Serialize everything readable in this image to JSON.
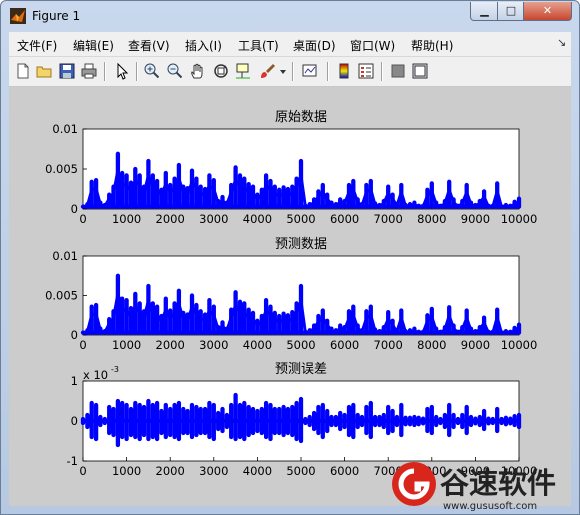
{
  "window": {
    "title": "Figure 1",
    "buttons": {
      "minimize": "▁",
      "maximize": "□",
      "close": "✕"
    }
  },
  "menu": {
    "items": [
      "文件(F)",
      "编辑(E)",
      "查看(V)",
      "插入(I)",
      "工具(T)",
      "桌面(D)",
      "窗口(W)",
      "帮助(H)"
    ],
    "overflow": "↘"
  },
  "toolbar": {
    "icons": [
      "new-figure-icon",
      "open-file-icon",
      "save-icon",
      "print-icon",
      "edit-plot-arrow-icon",
      "zoom-in-icon",
      "zoom-out-icon",
      "pan-hand-icon",
      "rotate-3d-icon",
      "data-cursor-icon",
      "brush-icon",
      "brush-dropdown-icon",
      "link-plot-icon",
      "colorbar-icon",
      "legend-icon",
      "hide-plot-tools-icon",
      "show-plot-tools-icon"
    ]
  },
  "chart_data": [
    {
      "type": "line",
      "title": "原始数据",
      "xlim": [
        0,
        10000
      ],
      "ylim": [
        0,
        0.01
      ],
      "x_ticks": [
        0,
        1000,
        2000,
        3000,
        4000,
        5000,
        6000,
        7000,
        8000,
        9000,
        10000
      ],
      "y_ticks": [
        "0",
        "0.005",
        "0.01"
      ],
      "y_tick_values": [
        0,
        0.005,
        0.01
      ],
      "series": [
        {
          "color": "#0000ff",
          "x": [
            0,
            100,
            200,
            300,
            400,
            500,
            600,
            700,
            800,
            900,
            1000,
            1100,
            1200,
            1300,
            1400,
            1500,
            1600,
            1700,
            1800,
            1900,
            2000,
            2100,
            2200,
            2300,
            2400,
            2500,
            2600,
            2700,
            2800,
            2900,
            3000,
            3100,
            3200,
            3300,
            3400,
            3500,
            3600,
            3700,
            3800,
            3900,
            4000,
            4100,
            4200,
            4300,
            4400,
            4500,
            4600,
            4700,
            4800,
            4900,
            5000,
            5100,
            5200,
            5300,
            5400,
            5500,
            5600,
            5700,
            5800,
            5900,
            6000,
            6100,
            6200,
            6300,
            6400,
            6500,
            6600,
            6700,
            6800,
            6900,
            7000,
            7100,
            7200,
            7300,
            7400,
            7500,
            7600,
            7700,
            7800,
            7900,
            8000,
            8100,
            8200,
            8300,
            8400,
            8500,
            8600,
            8700,
            8800,
            8900,
            9000,
            9100,
            9200,
            9300,
            9400,
            9500,
            9600,
            9700,
            9800,
            9900,
            10000
          ],
          "y": [
            0.0003,
            0.0006,
            0.0034,
            0.0036,
            0.0008,
            0.0005,
            0.0018,
            0.0028,
            0.0069,
            0.0045,
            0.0042,
            0.0033,
            0.005,
            0.0042,
            0.0028,
            0.006,
            0.0042,
            0.0035,
            0.0024,
            0.0045,
            0.003,
            0.0038,
            0.0055,
            0.0028,
            0.0026,
            0.0048,
            0.0038,
            0.0028,
            0.0025,
            0.0042,
            0.0036,
            0.001,
            0.0015,
            0.0008,
            0.003,
            0.0052,
            0.0042,
            0.0038,
            0.0031,
            0.0028,
            0.0018,
            0.0024,
            0.0042,
            0.0035,
            0.0028,
            0.0024,
            0.0027,
            0.0025,
            0.0028,
            0.0038,
            0.006,
            0.0004,
            0.0006,
            0.0012,
            0.0022,
            0.003,
            0.0018,
            0.0008,
            0.0006,
            0.0012,
            0.001,
            0.003,
            0.0035,
            0.0012,
            0.0006,
            0.003,
            0.0035,
            0.0007,
            0.0005,
            0.001,
            0.0028,
            0.0018,
            0.0006,
            0.003,
            0.0005,
            0.0006,
            0.0008,
            0.0004,
            0.0004,
            0.0024,
            0.0032,
            0.0008,
            0.0004,
            0.001,
            0.0034,
            0.0012,
            0.0004,
            0.001,
            0.003,
            0.0008,
            0.0005,
            0.001,
            0.0022,
            0.0004,
            0.0004,
            0.0032,
            0.0003,
            0.0005,
            0.0004,
            0.0009,
            0.0013
          ]
        }
      ]
    },
    {
      "type": "line",
      "title": "预测数据",
      "xlim": [
        0,
        10000
      ],
      "ylim": [
        0,
        0.01
      ],
      "x_ticks": [
        0,
        1000,
        2000,
        3000,
        4000,
        5000,
        6000,
        7000,
        8000,
        9000,
        10000
      ],
      "y_ticks": [
        "0",
        "0.005",
        "0.01"
      ],
      "y_tick_values": [
        0,
        0.005,
        0.01
      ],
      "series": [
        {
          "color": "#0000ff",
          "x": [
            0,
            100,
            200,
            300,
            400,
            500,
            600,
            700,
            800,
            900,
            1000,
            1100,
            1200,
            1300,
            1400,
            1500,
            1600,
            1700,
            1800,
            1900,
            2000,
            2100,
            2200,
            2300,
            2400,
            2500,
            2600,
            2700,
            2800,
            2900,
            3000,
            3100,
            3200,
            3300,
            3400,
            3500,
            3600,
            3700,
            3800,
            3900,
            4000,
            4100,
            4200,
            4300,
            4400,
            4500,
            4600,
            4700,
            4800,
            4900,
            5000,
            5100,
            5200,
            5300,
            5400,
            5500,
            5600,
            5700,
            5800,
            5900,
            6000,
            6100,
            6200,
            6300,
            6400,
            6500,
            6600,
            6700,
            6800,
            6900,
            7000,
            7100,
            7200,
            7300,
            7400,
            7500,
            7600,
            7700,
            7800,
            7900,
            8000,
            8100,
            8200,
            8300,
            8400,
            8500,
            8600,
            8700,
            8800,
            8900,
            9000,
            9100,
            9200,
            9300,
            9400,
            9500,
            9600,
            9700,
            9800,
            9900,
            10000
          ],
          "y": [
            0.0003,
            0.0006,
            0.0036,
            0.0038,
            0.0008,
            0.0005,
            0.002,
            0.003,
            0.0075,
            0.0046,
            0.0044,
            0.0034,
            0.0052,
            0.004,
            0.003,
            0.0062,
            0.004,
            0.0036,
            0.0024,
            0.0046,
            0.0031,
            0.004,
            0.0056,
            0.0028,
            0.0026,
            0.005,
            0.0038,
            0.003,
            0.0026,
            0.0044,
            0.0036,
            0.001,
            0.0016,
            0.0008,
            0.0032,
            0.0054,
            0.0042,
            0.004,
            0.0032,
            0.0028,
            0.0018,
            0.0024,
            0.0044,
            0.0036,
            0.0028,
            0.0024,
            0.0027,
            0.0025,
            0.0029,
            0.004,
            0.0062,
            0.0004,
            0.0006,
            0.0012,
            0.0024,
            0.0031,
            0.0018,
            0.0008,
            0.0006,
            0.0012,
            0.001,
            0.003,
            0.0036,
            0.0012,
            0.0006,
            0.003,
            0.0036,
            0.0007,
            0.0005,
            0.001,
            0.0029,
            0.0018,
            0.0006,
            0.0031,
            0.0005,
            0.0006,
            0.0008,
            0.0004,
            0.0004,
            0.0025,
            0.0033,
            0.0008,
            0.0004,
            0.001,
            0.0035,
            0.0012,
            0.0004,
            0.001,
            0.0031,
            0.0008,
            0.0005,
            0.001,
            0.0022,
            0.0004,
            0.0004,
            0.0032,
            0.0003,
            0.0005,
            0.0004,
            0.0009,
            0.0013
          ]
        }
      ]
    },
    {
      "type": "line",
      "title": "预测误差",
      "xlim": [
        0,
        10000
      ],
      "ylim": [
        -1,
        1
      ],
      "exponent_label": "x 10",
      "exponent_power": "-3",
      "x_ticks": [
        0,
        1000,
        2000,
        3000,
        4000,
        5000,
        6000,
        7000,
        8000,
        9000,
        10000
      ],
      "y_ticks": [
        "-1",
        "0",
        "1"
      ],
      "y_tick_values": [
        -1,
        0,
        1
      ],
      "series": [
        {
          "color": "#0000ff",
          "x": [
            0,
            100,
            200,
            300,
            400,
            500,
            600,
            700,
            800,
            900,
            1000,
            1100,
            1200,
            1300,
            1400,
            1500,
            1600,
            1700,
            1800,
            1900,
            2000,
            2100,
            2200,
            2300,
            2400,
            2500,
            2600,
            2700,
            2800,
            2900,
            3000,
            3100,
            3200,
            3300,
            3400,
            3500,
            3600,
            3700,
            3800,
            3900,
            4000,
            4100,
            4200,
            4300,
            4400,
            4500,
            4600,
            4700,
            4800,
            4900,
            5000,
            5100,
            5200,
            5300,
            5400,
            5500,
            5600,
            5700,
            5800,
            5900,
            6000,
            6100,
            6200,
            6300,
            6400,
            6500,
            6600,
            6700,
            6800,
            6900,
            7000,
            7100,
            7200,
            7300,
            7400,
            7500,
            7600,
            7700,
            7800,
            7900,
            8000,
            8100,
            8200,
            8300,
            8400,
            8500,
            8600,
            8700,
            8800,
            8900,
            9000,
            9100,
            9200,
            9300,
            9400,
            9500,
            9600,
            9700,
            9800,
            9900,
            10000
          ],
          "y_upper": [
            0.05,
            0.15,
            0.45,
            0.4,
            0.1,
            0.05,
            0.35,
            0.3,
            0.5,
            0.45,
            0.4,
            0.3,
            0.45,
            0.4,
            0.35,
            0.5,
            0.4,
            0.45,
            0.25,
            0.4,
            0.3,
            0.4,
            0.45,
            0.3,
            0.25,
            0.4,
            0.35,
            0.3,
            0.3,
            0.45,
            0.4,
            0.2,
            0.3,
            0.15,
            0.4,
            0.65,
            0.4,
            0.45,
            0.35,
            0.3,
            0.25,
            0.3,
            0.45,
            0.4,
            0.3,
            0.3,
            0.35,
            0.3,
            0.35,
            0.45,
            0.55,
            0.05,
            0.1,
            0.2,
            0.35,
            0.4,
            0.25,
            0.1,
            0.1,
            0.2,
            0.15,
            0.35,
            0.4,
            0.15,
            0.1,
            0.35,
            0.45,
            0.1,
            0.1,
            0.15,
            0.35,
            0.25,
            0.1,
            0.4,
            0.08,
            0.08,
            0.1,
            0.08,
            0.06,
            0.3,
            0.35,
            0.1,
            0.05,
            0.15,
            0.4,
            0.15,
            0.05,
            0.15,
            0.35,
            0.1,
            0.06,
            0.1,
            0.25,
            0.06,
            0.05,
            0.3,
            0.05,
            0.08,
            0.06,
            0.12,
            0.15
          ],
          "y_lower": [
            -0.05,
            -0.15,
            -0.4,
            -0.45,
            -0.1,
            -0.05,
            -0.3,
            -0.35,
            -0.6,
            -0.4,
            -0.45,
            -0.35,
            -0.4,
            -0.45,
            -0.35,
            -0.45,
            -0.4,
            -0.45,
            -0.3,
            -0.4,
            -0.35,
            -0.4,
            -0.45,
            -0.3,
            -0.3,
            -0.4,
            -0.35,
            -0.3,
            -0.3,
            -0.4,
            -0.45,
            -0.2,
            -0.25,
            -0.15,
            -0.4,
            -0.45,
            -0.4,
            -0.45,
            -0.35,
            -0.3,
            -0.25,
            -0.3,
            -0.4,
            -0.45,
            -0.3,
            -0.3,
            -0.35,
            -0.3,
            -0.35,
            -0.45,
            -0.5,
            -0.05,
            -0.1,
            -0.2,
            -0.3,
            -0.4,
            -0.25,
            -0.1,
            -0.1,
            -0.2,
            -0.15,
            -0.35,
            -0.4,
            -0.15,
            -0.1,
            -0.3,
            -0.4,
            -0.1,
            -0.1,
            -0.15,
            -0.3,
            -0.25,
            -0.1,
            -0.35,
            -0.08,
            -0.08,
            -0.1,
            -0.08,
            -0.06,
            -0.25,
            -0.3,
            -0.1,
            -0.05,
            -0.15,
            -0.35,
            -0.15,
            -0.05,
            -0.15,
            -0.3,
            -0.1,
            -0.06,
            -0.1,
            -0.2,
            -0.06,
            -0.05,
            -0.25,
            -0.05,
            -0.08,
            -0.06,
            -0.1,
            -0.15
          ]
        }
      ]
    }
  ],
  "watermark": {
    "brand": "谷速软件",
    "url": "www.gususoft.com",
    "colors": {
      "red": "#d9261c",
      "dark": "#222222"
    }
  }
}
